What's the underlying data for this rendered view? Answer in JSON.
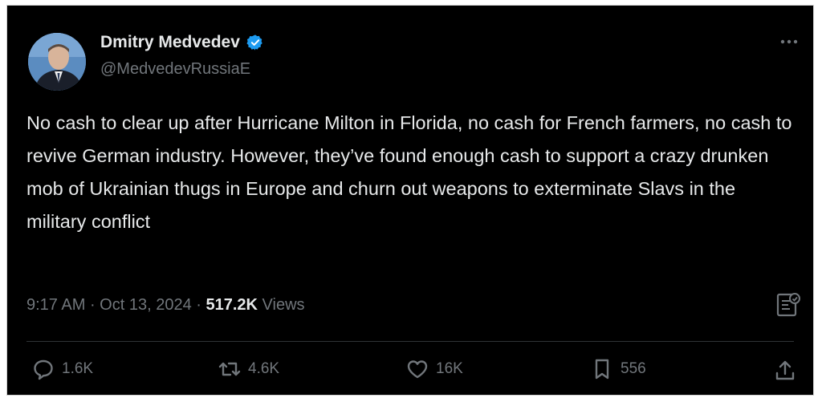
{
  "author": {
    "name": "Dmitry Medvedev",
    "handle": "@MedvedevRussiaE",
    "avatar_icon": "profile-photo",
    "verified_icon": "verified-badge-icon",
    "verified_color": "#1d9bf0"
  },
  "tweet": {
    "text": "No cash to clear up after Hurricane Milton in Florida, no cash for French farmers, no cash to revive German industry. However, they’ve found enough cash to support a crazy drunken mob of Ukrainian thugs in Europe and churn out weapons to exterminate Slavs in the military conflict",
    "time": "9:17 AM",
    "date": "Oct 13, 2024",
    "separator": " · ",
    "views_count": "517.2K",
    "views_label": " Views"
  },
  "actions": {
    "replies": "1.6K",
    "reposts": "4.6K",
    "likes": "16K",
    "bookmarks": "556"
  },
  "colors": {
    "background": "#000000",
    "text": "#e7e9ea",
    "secondary": "#71767b",
    "divider": "#2f3336"
  }
}
